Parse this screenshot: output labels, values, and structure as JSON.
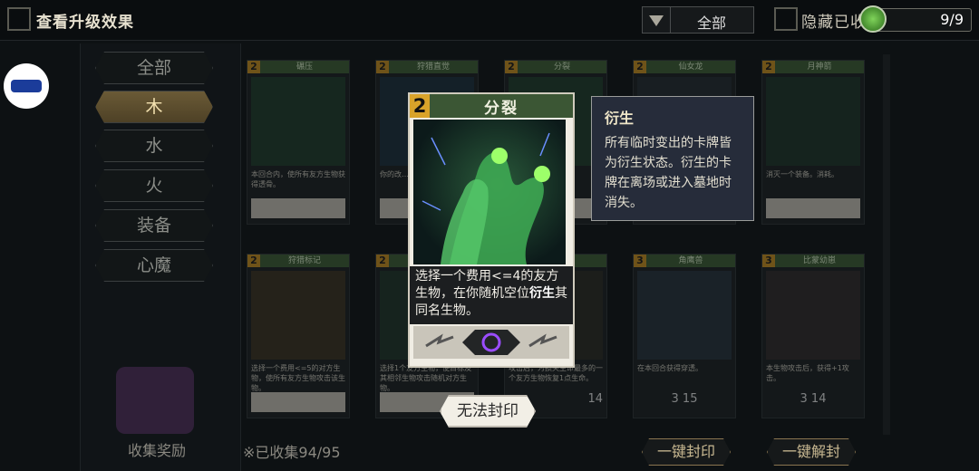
{
  "header": {
    "title": "查看升级效果",
    "filter_value": "全部",
    "hide_label": "隐藏已收",
    "counter": "9/9"
  },
  "sidebar": {
    "categories": [
      "全部",
      "木",
      "水",
      "火",
      "装备",
      "心魔"
    ],
    "active_index": 1,
    "reward_label": "收集奖励"
  },
  "cards": [
    {
      "cost": "2",
      "name": "碾压",
      "desc": "本回合内，使所有友方生物获得透骨。",
      "stats": ""
    },
    {
      "cost": "2",
      "name": "狩猎直觉",
      "desc": "你的改…物。使用…张）",
      "stats": ""
    },
    {
      "cost": "2",
      "name": "分裂",
      "desc": "…<=4的…机空位",
      "stats": ""
    },
    {
      "cost": "2",
      "name": "仙女龙",
      "desc": "",
      "stats": ""
    },
    {
      "cost": "2",
      "name": "月神箭",
      "desc": "消灭一个装备。消耗。",
      "stats": ""
    },
    {
      "cost": "2",
      "name": "狩猎标记",
      "desc": "选择一个费用<=5的对方生物，使所有友方生物攻击该生物。",
      "stats": ""
    },
    {
      "cost": "2",
      "name": "",
      "desc": "选择1个友方生物，使目标及其相邻生物攻击随机对方生物。",
      "stats": ""
    },
    {
      "cost": "2",
      "name": "",
      "desc": "攻击后，为损失生命最多的一个友方生物恢复1点生命。",
      "stats": "14"
    },
    {
      "cost": "3",
      "name": "角鹰兽",
      "desc": "在本回合获得穿透。",
      "stats": "3 15"
    },
    {
      "cost": "3",
      "name": "比蒙幼崽",
      "desc": "本生物攻击后，获得+1攻击。",
      "stats": "3 14"
    }
  ],
  "footer": {
    "collected": "※已收集94/95",
    "seal_all": "一键封印",
    "unseal_all": "一键解封"
  },
  "detail_card": {
    "cost": "2",
    "name": "分裂",
    "text_before": "选择一个费用<=4的友方生物，在你随机空位",
    "keyword": "衍生",
    "text_after": "其同名生物。"
  },
  "tooltip": {
    "title": "衍生",
    "body": "所有临时变出的卡牌皆为衍生状态。衍生的卡牌在离场或进入墓地时消失。"
  },
  "seal_button": "无法封印"
}
